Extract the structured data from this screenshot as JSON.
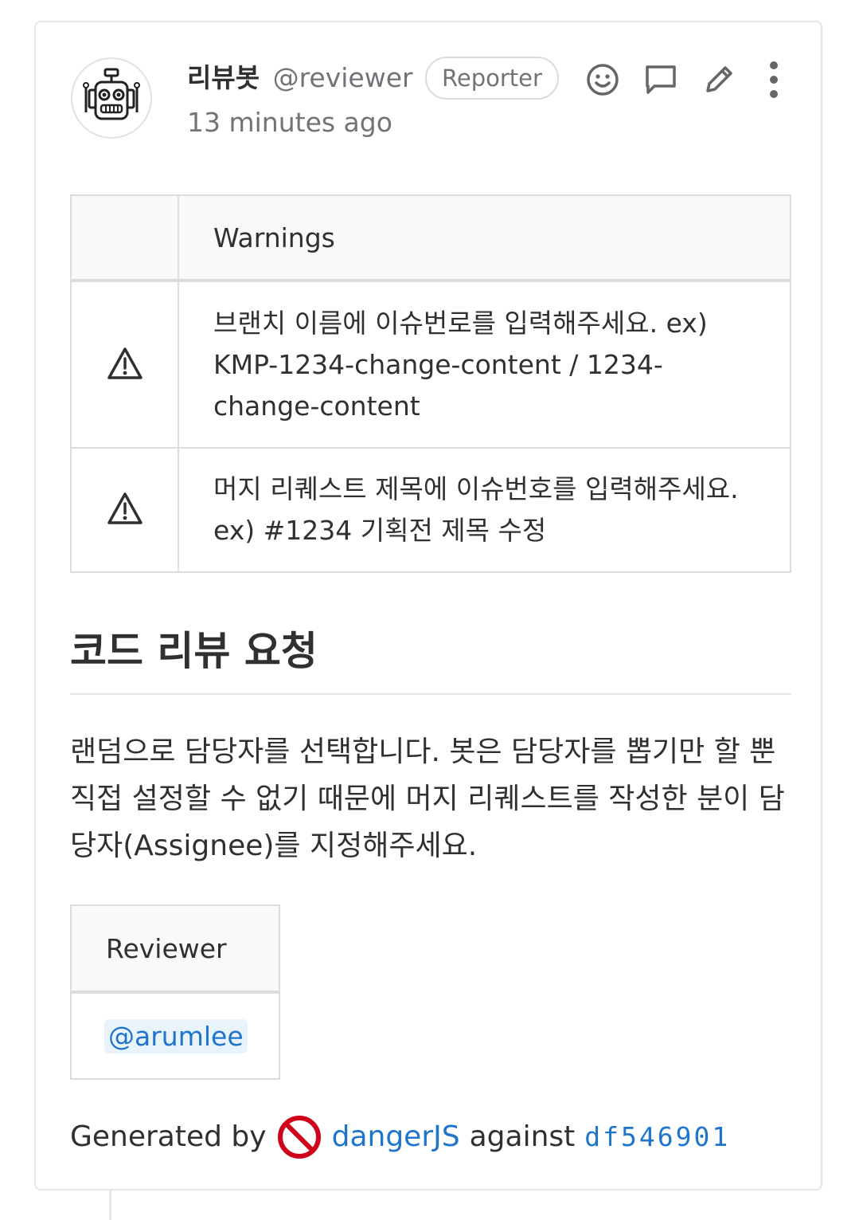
{
  "comment": {
    "author_name": "리뷰봇",
    "author_handle": "@reviewer",
    "role_badge": "Reporter",
    "timestamp": "13 minutes ago",
    "actions": [
      "smiley-icon",
      "comment-icon",
      "pencil-icon",
      "kebab-menu-icon"
    ]
  },
  "warnings_table": {
    "header": "Warnings",
    "rows": [
      {
        "icon": "warning-icon",
        "message": "브랜치 이름에 이슈번로를 입력해주세요. ex) KMP-1234-change-content / 1234-change-content"
      },
      {
        "icon": "warning-icon",
        "message": "머지 리퀘스트 제목에 이슈번호를 입력해주세요. ex) #1234 기획전 제목 수정"
      }
    ]
  },
  "section": {
    "heading": "코드 리뷰 요청",
    "paragraph": "랜덤으로 담당자를 선택합니다. 봇은 담당자를 뽑기만 할 뿐 직접 설정할 수 없기 때문에 머지 리퀘스트를 작성한 분이 담당자(Assignee)를 지정해주세요."
  },
  "reviewer_table": {
    "header": "Reviewer",
    "rows": [
      "@arumlee"
    ]
  },
  "footer": {
    "generated_by": "Generated by",
    "tool_link": "dangerJS",
    "against": "against",
    "commit_hash": "df546901"
  },
  "colors": {
    "link": "#1f75cb",
    "mention_bg": "#e9f3fc",
    "muted_text": "#737278",
    "border": "#dcdcde"
  }
}
